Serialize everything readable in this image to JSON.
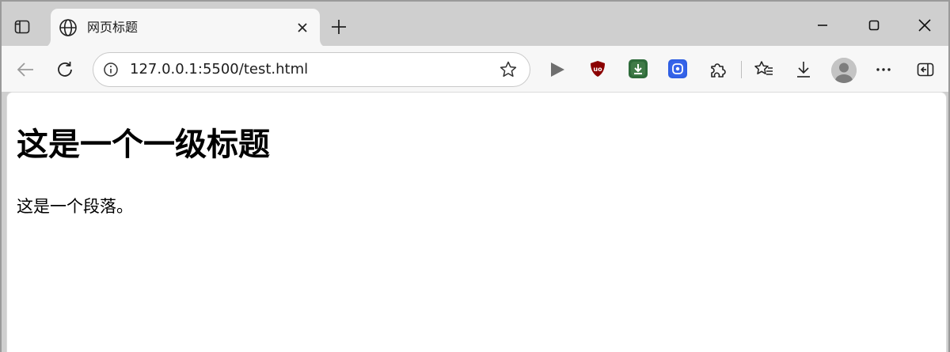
{
  "tab": {
    "title": "网页标题",
    "favicon": "globe-icon"
  },
  "address_bar": {
    "url": "127.0.0.1:5500/test.html"
  },
  "extensions": [
    {
      "name": "play-icon"
    },
    {
      "name": "ublock-shield-icon",
      "color": "#8b0000"
    },
    {
      "name": "download-manager-icon",
      "color": "#2e6b3a"
    },
    {
      "name": "screen-capture-icon",
      "color": "#2f5fe3"
    }
  ],
  "page": {
    "heading": "这是一个一级标题",
    "paragraph": "这是一个段落。"
  }
}
